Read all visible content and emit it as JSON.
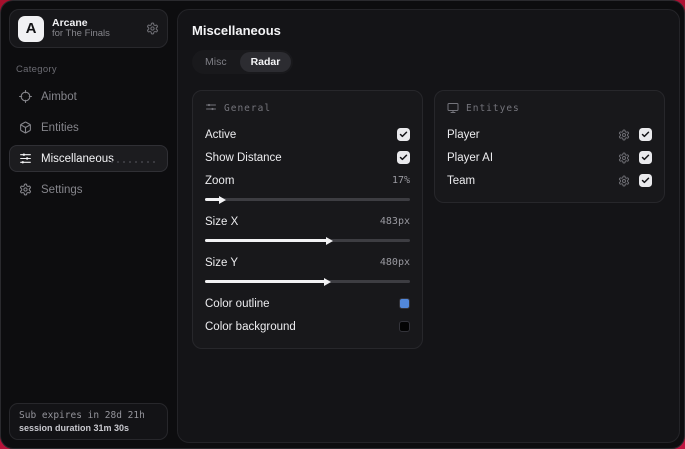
{
  "sidebar": {
    "profile": {
      "initial": "A",
      "name": "Arcane",
      "subtitle": "for The Finals"
    },
    "category_label": "Category",
    "items": [
      {
        "label": "Aimbot",
        "icon": "crosshair-icon",
        "active": false
      },
      {
        "label": "Entities",
        "icon": "cube-icon",
        "active": false
      },
      {
        "label": "Miscellaneous",
        "icon": "sliders-icon",
        "active": true
      },
      {
        "label": "Settings",
        "icon": "gear-icon",
        "active": false
      }
    ],
    "subscription": {
      "line1": "Sub expires in 28d 21h",
      "line2": "session duration 31m 30s"
    }
  },
  "main": {
    "title": "Miscellaneous",
    "tabs": [
      {
        "label": "Misc",
        "active": false
      },
      {
        "label": "Radar",
        "active": true
      }
    ],
    "general": {
      "title": "General",
      "icon": "sliders-icon",
      "toggles": [
        {
          "label": "Active",
          "checked": true
        },
        {
          "label": "Show Distance",
          "checked": true
        }
      ],
      "sliders": [
        {
          "label": "Zoom",
          "value": "17%",
          "percent": 8
        },
        {
          "label": "Size X",
          "value": "483px",
          "percent": 60
        },
        {
          "label": "Size Y",
          "value": "480px",
          "percent": 59
        }
      ],
      "colors": [
        {
          "label": "Color outline",
          "color": "#5288db"
        },
        {
          "label": "Color background",
          "color": "#040404"
        }
      ]
    },
    "entities": {
      "title": "Entityes",
      "icon": "monitor-icon",
      "rows": [
        {
          "label": "Player",
          "checked": true
        },
        {
          "label": "Player AI",
          "checked": true
        },
        {
          "label": "Team",
          "checked": true
        }
      ]
    }
  },
  "colors": {
    "accent_blue": "#5288db",
    "desktop_red": "#b01236"
  }
}
